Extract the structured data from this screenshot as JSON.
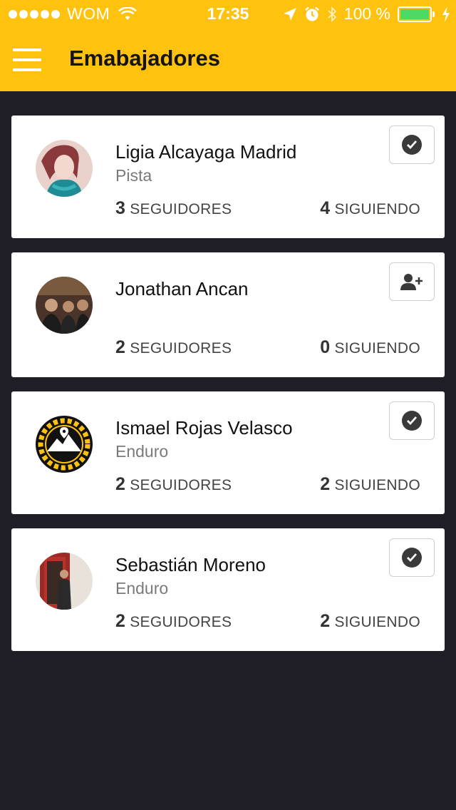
{
  "status_bar": {
    "carrier": "WOM",
    "time": "17:35",
    "battery": "100 %",
    "battery_level": 1.0,
    "icons": [
      "signal-dots-icon",
      "wifi-icon",
      "location-arrow-icon",
      "alarm-icon",
      "bluetooth-icon",
      "battery-icon",
      "charging-bolt-icon"
    ]
  },
  "app_bar": {
    "title": "Emabajadores",
    "menu_icon": "hamburger-menu-icon"
  },
  "colors": {
    "accent": "#ffc20e",
    "background": "#1f1e26",
    "card": "#ffffff",
    "battery": "#4cd964"
  },
  "ambassadors": [
    {
      "name": "Ligia Alcayaga Madrid",
      "category": "Pista",
      "followers_count": "3",
      "followers_label": "SEGUIDORES",
      "following_count": "4",
      "following_label": "SIGUIENDO",
      "action_icon": "check-circle-icon"
    },
    {
      "name": "Jonathan Ancan",
      "category": "",
      "followers_count": "2",
      "followers_label": "SEGUIDORES",
      "following_count": "0",
      "following_label": "SIGUIENDO",
      "action_icon": "add-user-icon"
    },
    {
      "name": "Ismael Rojas Velasco",
      "category": "Enduro",
      "followers_count": "2",
      "followers_label": "SEGUIDORES",
      "following_count": "2",
      "following_label": "SIGUIENDO",
      "action_icon": "check-circle-icon"
    },
    {
      "name": "Sebastián Moreno",
      "category": "Enduro",
      "followers_count": "2",
      "followers_label": "SEGUIDORES",
      "following_count": "2",
      "following_label": "SIGUIENDO",
      "action_icon": "check-circle-icon"
    }
  ]
}
